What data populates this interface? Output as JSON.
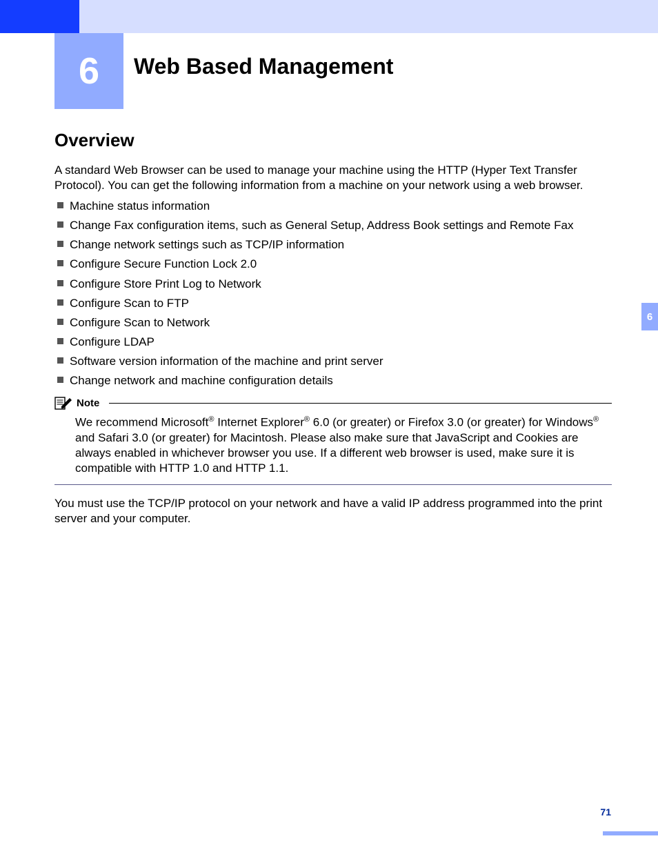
{
  "chapter": {
    "number": "6",
    "title": "Web Based Management"
  },
  "section_title": "Overview",
  "intro": "A standard Web Browser can be used to manage your machine using the HTTP (Hyper Text Transfer Protocol). You can get the following information from a machine on your network using a web browser.",
  "bullets": [
    "Machine status information",
    "Change Fax configuration items, such as General Setup, Address Book settings and Remote Fax",
    "Change network settings such as TCP/IP information",
    "Configure Secure Function Lock 2.0",
    "Configure Store Print Log to Network",
    "Configure Scan to FTP",
    "Configure Scan to Network",
    "Configure LDAP",
    "Software version information of the machine and print server",
    "Change network and machine configuration details"
  ],
  "note": {
    "label": "Note",
    "pre1": "We recommend Microsoft",
    "reg1": "®",
    "mid1": " Internet Explorer",
    "reg2": "®",
    "mid2": " 6.0 (or greater) or Firefox 3.0 (or greater) for Windows",
    "reg3": "®",
    "post": " and Safari 3.0 (or greater) for Macintosh. Please also make sure that JavaScript and Cookies are always enabled in whichever browser you use. If a different web browser is used, make sure it is compatible with HTTP 1.0 and HTTP 1.1."
  },
  "after_note": "You must use the TCP/IP protocol on your network and have a valid IP address programmed into the print server and your computer.",
  "side_tab": "6",
  "page_number": "71"
}
